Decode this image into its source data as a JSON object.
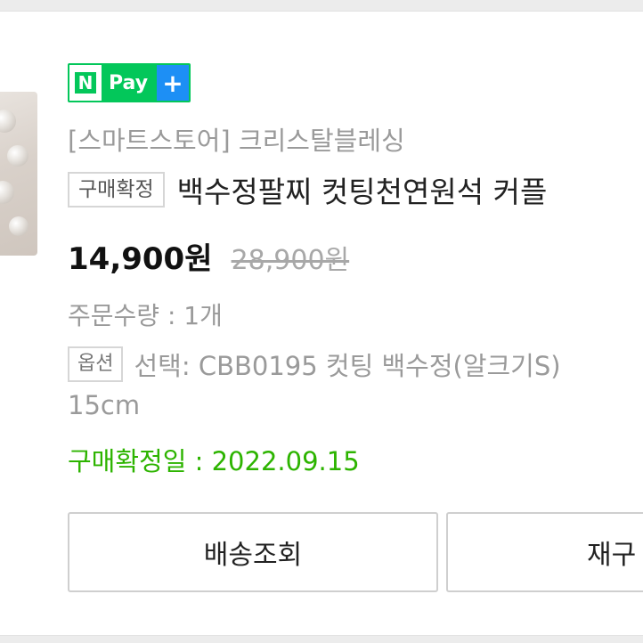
{
  "npay": {
    "n": "N",
    "pay": "Pay",
    "plus": "+"
  },
  "store_label": "[스마트스토어] 크리스탈블레싱",
  "status_badge": "구매확정",
  "product_title": "백수정팔찌 컷팅천연원석 커플",
  "price": "14,900원",
  "original_price": "28,900원",
  "quantity": "주문수량 : 1개",
  "option_badge": "옵션",
  "option_text": "선택: CBB0195 컷팅 백수정(알크기S)",
  "option_cont": "15cm",
  "confirm_date": "구매확정일 : 2022.09.15",
  "buttons": {
    "track": "배송조회",
    "reorder": "재구"
  },
  "colors": {
    "green": "#2db400",
    "npay_green": "#03c75a",
    "npay_blue": "#1d8ff5"
  },
  "icons": {
    "thumbnail": "product-thumbnail",
    "plus": "plus-icon"
  }
}
